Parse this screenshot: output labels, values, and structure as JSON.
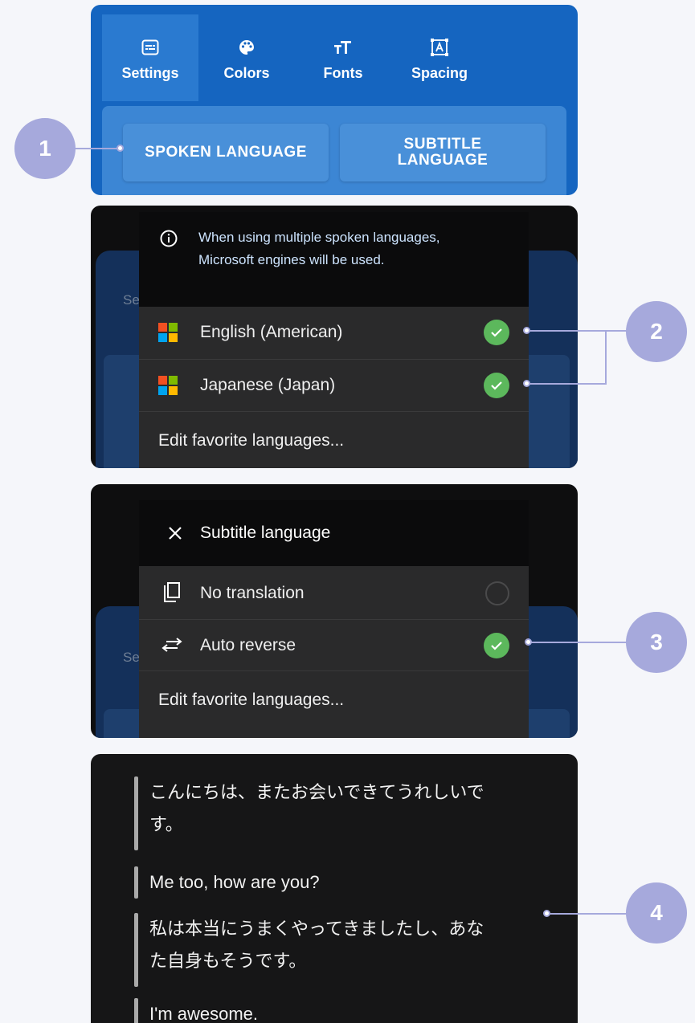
{
  "tabs": [
    {
      "label": "Settings",
      "icon": "subtitles-icon",
      "active": true
    },
    {
      "label": "Colors",
      "icon": "palette-icon",
      "active": false
    },
    {
      "label": "Fonts",
      "icon": "text-size-icon",
      "active": false
    },
    {
      "label": "Spacing",
      "icon": "spacing-icon",
      "active": false
    }
  ],
  "language_buttons": {
    "spoken": "SPOKEN LANGUAGE",
    "subtitle": "SUBTITLE\nLANGUAGE"
  },
  "spoken_menu": {
    "info": "When using multiple spoken languages,\nMicrosoft engines will be used.",
    "items": [
      {
        "label": "English (American)",
        "checked": true
      },
      {
        "label": "Japanese (Japan)",
        "checked": true
      }
    ],
    "edit_label": "Edit favorite languages...",
    "ghost_label": "Se"
  },
  "subtitle_menu": {
    "title": "Subtitle language",
    "items": [
      {
        "label": "No translation",
        "checked": false,
        "icon": "copy-icon"
      },
      {
        "label": "Auto reverse",
        "checked": true,
        "icon": "swap-icon"
      }
    ],
    "edit_label": "Edit favorite languages...",
    "ghost_label": "Se"
  },
  "subtitles": [
    "こんにちは、またお会いできてうれしいで\nす。",
    "Me too, how are you?",
    "私は本当にうまくやってきましたし、あな\nた自身もそうです。",
    "I'm awesome."
  ],
  "callouts": [
    "1",
    "2",
    "3",
    "4"
  ],
  "colors": {
    "accent_blue": "#1565c0",
    "callout": "#a6a9dc",
    "check_green": "#5cb85c"
  }
}
